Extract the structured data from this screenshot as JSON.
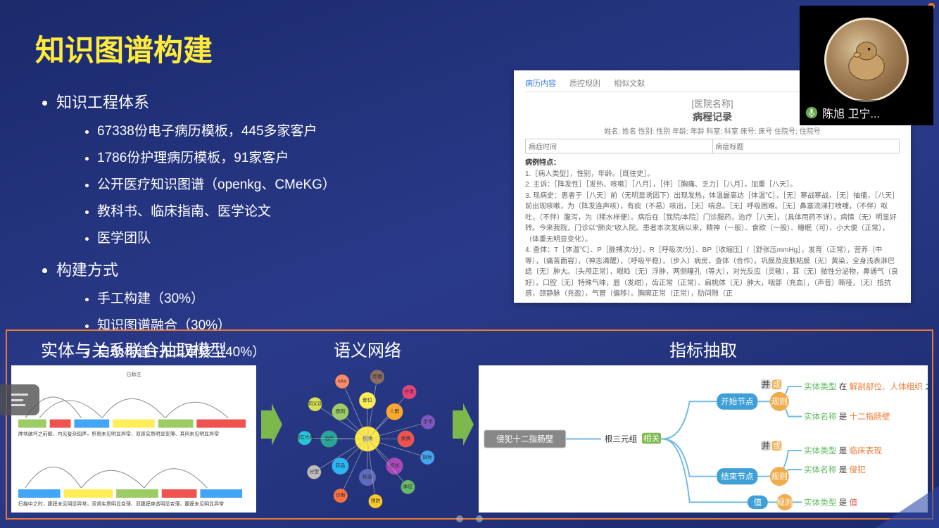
{
  "title": "知识图谱构建",
  "speaker": "陈旭 卫宁...",
  "bullets": {
    "b1": "知识工程体系",
    "b1_1": "67338份电子病历模板，445多家客户",
    "b1_2": "1786份护理病历模板，91家客户",
    "b1_3": "公开医疗知识图谱（openkg、CMeKG）",
    "b1_4": "教科书、临床指南、医学论文",
    "b1_5": "医学团队",
    "b2": "构建方式",
    "b2_1": "手工构建（30%）",
    "b2_2": "知识图谱融合（30%）",
    "b2_3": "自动构建+人工审核（40%）"
  },
  "doc": {
    "tab1": "病历内容",
    "tab2": "质控规则",
    "tab3": "相似文献",
    "hospital": "[医院名称]",
    "record": "病程记录",
    "header": "姓名: 姓名  性别: 性别  年龄: 年龄  科室: 科室  床号: 床号  住院号: 住院号",
    "row_l": "病症时间",
    "row_r": "病症标题",
    "body_title": "病例特点：",
    "p1": "1.［病人类型］，性别，年龄。［既往史］。",
    "p2": "2. 主诉：［阵发性］［发热、咳嗽］［八月］，［伴］［胸痛、乏力］［八月］，加重［八天］。",
    "p3": "3. 现病史：患者于［八天］前（无明显诱因下）出现发热，体温最高达［体温℃］，［无］寒战寒战，［无］抽搐，［八天］前出现咳嗽，为（阵发连声咳），有痰（不易）咳出，［无］喘息。［无］呼吸困难。［无］鼻塞流涕打喷嚏，（不伴）呕吐，（不伴）腹泻，为（稀水样便）。病后在［我院/本院］门诊服药，治疗［八天］，（具体用药不详），病情（无）明显好转。今来我院，门诊以\"肺炎\"收入院。患者本次发病以来，精神（一般）、食欲（一般）、睡眠（可）、小大便（正常），（体重无明显变化）。",
    "p4": "4. 查体：T［体温℃］、P［脉搏次/分］、R［呼吸次/分］、BP［收缩压］/［舒张压mmHg］，发育（正常），营养（中等），〔痛苦面容〕，（神志清醒），〔呼吸平稳〕，〔步入〕病房，查体（合作）。巩膜及皮肤粘膜〔无〕黄染，全身浅表淋巴结〔无〕肿大。〔头颅正常〕，眼睑〔无〕浮肿，两侧瞳孔（等大），对光反应（灵敏），耳〔无〕脓性分泌物，鼻通气（良好）。口腔〔无〕特殊气味，唇（发绀），齿正常（正常）、扁桃体（无）肿大，咽部（充血），（声音）嘶哑，（无）抵抗感，颈静脉（充盈），气管（偏移）。胸廓正常（正常），肋间隙（正"
  },
  "panels": {
    "p1_title": "实体与关系联合抽取模型",
    "p2_title": "语义网络",
    "p3_title": "指标抽取"
  },
  "indicator": {
    "root": "侵犯十二指肠壁",
    "triple": "根三元组",
    "rel": "相关",
    "start": "开始节点",
    "end": "结束节点",
    "value": "值",
    "rule": "规则",
    "and": "并",
    "or": "或",
    "r1a": "实体类型",
    "r1a_v": "在",
    "r1a_obj": "解剖部位、人体组织",
    "r1a_suf": "之中",
    "r1b": "实体名称",
    "r1b_v": "是",
    "r1b_obj": "十二指肠壁",
    "r2a": "实体类型",
    "r2a_v": "是",
    "r2a_obj": "临床表现",
    "r2b": "实体名称",
    "r2b_v": "是",
    "r2b_obj": "侵犯",
    "r3": "实体类型",
    "r3_v": "是",
    "r3_obj": "值"
  },
  "network_nodes": [
    "疾病",
    "症状",
    "检查",
    "药品",
    "治疗",
    "原因",
    "部位",
    "人群",
    "传播",
    "并发",
    "手术",
    "指标",
    "体征",
    "预防",
    "诊断",
    "分型",
    "相互作用",
    "同义词",
    "nAo"
  ],
  "icons": {
    "mic": "mic-icon",
    "menu": "menu-icon",
    "close": "close-icon"
  }
}
